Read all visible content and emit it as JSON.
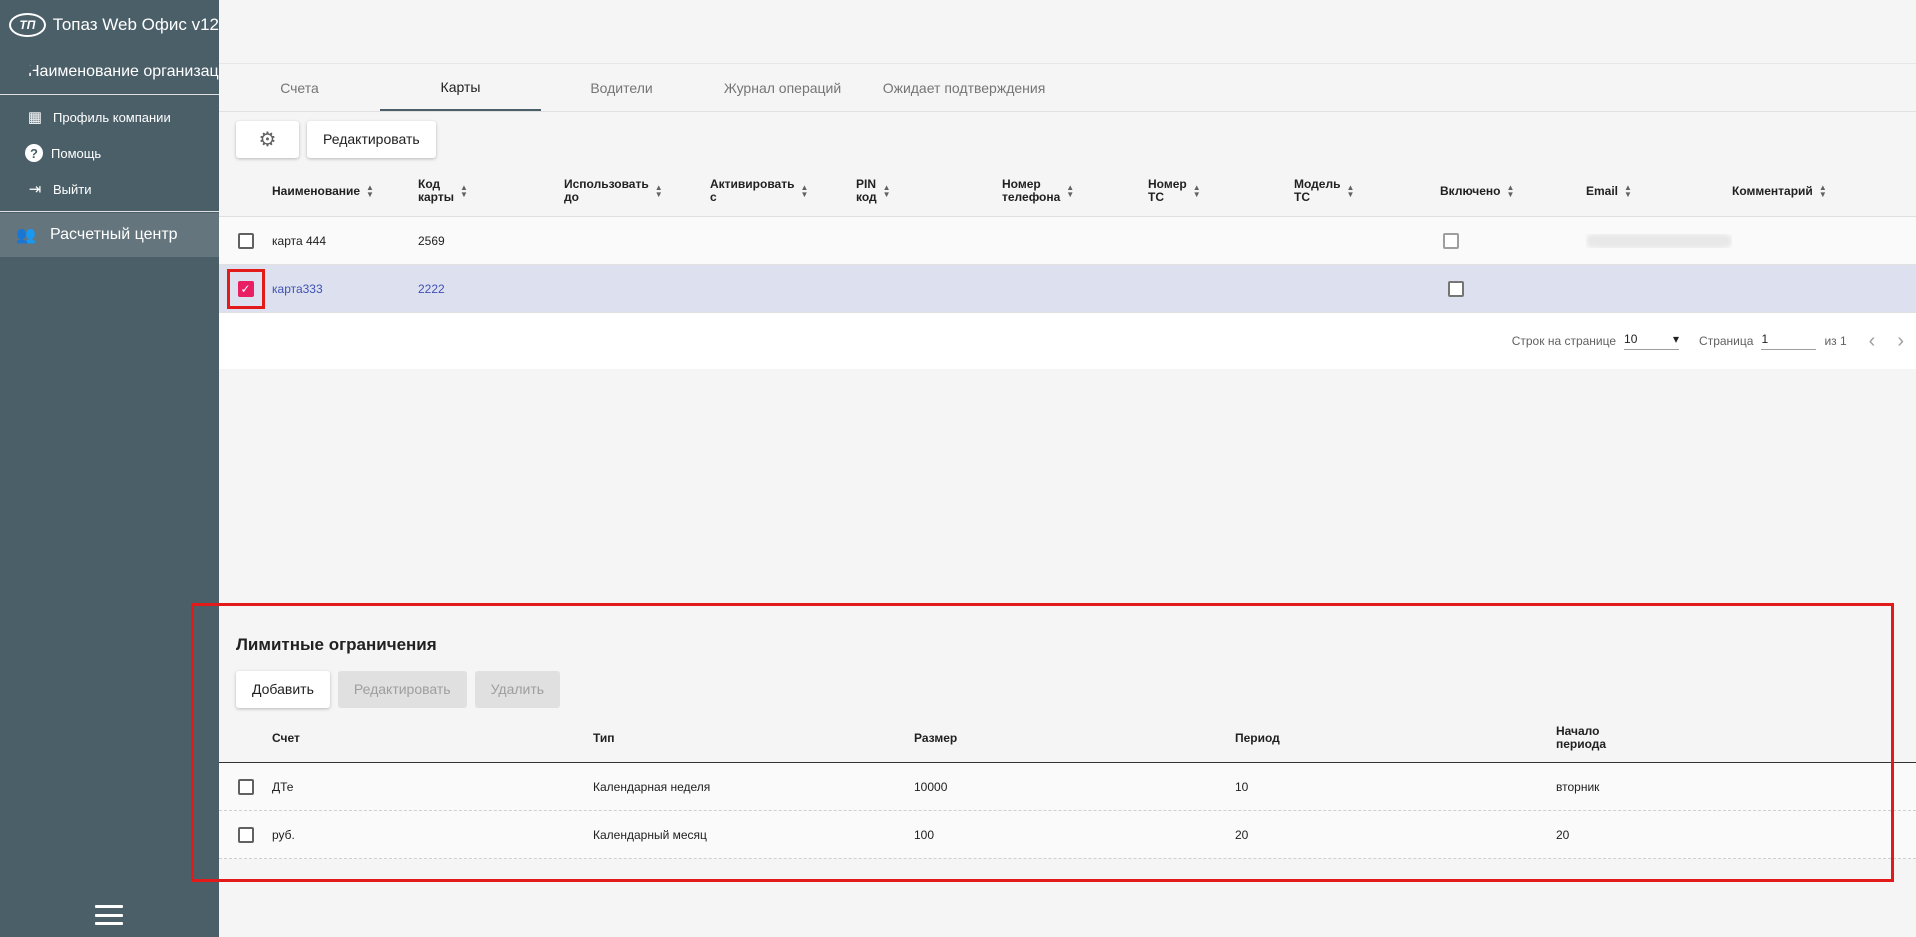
{
  "app": {
    "title": "Топаз Web Офис v12",
    "logo_text": "ТП"
  },
  "sidebar": {
    "org_name": "Наименование организации",
    "items": [
      {
        "label": "Профиль компании",
        "icon": "building-icon"
      },
      {
        "label": "Помощь",
        "icon": "help-icon"
      },
      {
        "label": "Выйти",
        "icon": "logout-icon"
      }
    ],
    "center": "Расчетный центр"
  },
  "tabs": [
    "Счета",
    "Карты",
    "Водители",
    "Журнал операций",
    "Ожидает подтверждения"
  ],
  "active_tab": "Карты",
  "toolbar": {
    "edit": "Редактировать"
  },
  "cards": {
    "columns": [
      {
        "l1": "Наименование",
        "l2": ""
      },
      {
        "l1": "Код",
        "l2": "карты"
      },
      {
        "l1": "Использовать",
        "l2": "до"
      },
      {
        "l1": "Активировать",
        "l2": "с"
      },
      {
        "l1": "PIN",
        "l2": "код"
      },
      {
        "l1": "Номер",
        "l2": "телефона"
      },
      {
        "l1": "Номер",
        "l2": "ТС"
      },
      {
        "l1": "Модель",
        "l2": "ТС"
      },
      {
        "l1": "Включено",
        "l2": ""
      },
      {
        "l1": "Email",
        "l2": ""
      },
      {
        "l1": "Комментарий",
        "l2": ""
      }
    ],
    "rows": [
      {
        "name": "карта 444",
        "code": "2569",
        "checked": false
      },
      {
        "name": "карта333",
        "code": "2222",
        "checked": true
      }
    ]
  },
  "pager": {
    "rows_label": "Строк на странице",
    "rows_value": "10",
    "page_label": "Страница",
    "page_value": "1",
    "of": "из 1"
  },
  "limits": {
    "title": "Лимитные ограничения",
    "add": "Добавить",
    "edit": "Редактировать",
    "delete": "Удалить",
    "columns": {
      "c1": "Счет",
      "c2": "Тип",
      "c3": "Размер",
      "c4": "Период",
      "c5a": "Начало",
      "c5b": "периода"
    },
    "rows": [
      {
        "account": "ДТе",
        "type": "Календарная неделя",
        "size": "10000",
        "period": "10",
        "start": "вторник"
      },
      {
        "account": "руб.",
        "type": "Календарный месяц",
        "size": "100",
        "period": "20",
        "start": "20"
      }
    ]
  },
  "colors": {
    "sidebar": "#4b5f69",
    "accent": "#e91e63",
    "highlight": "#e21a1a"
  }
}
